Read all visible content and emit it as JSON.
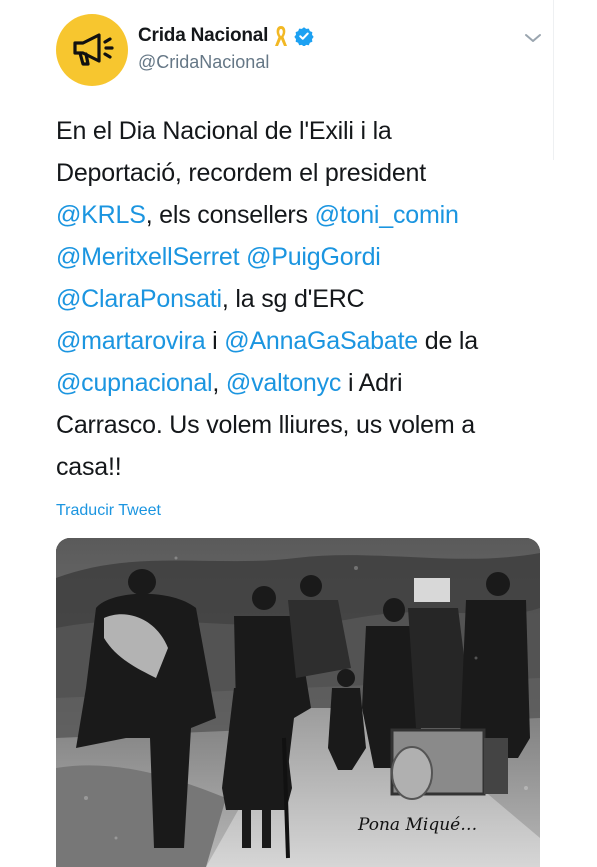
{
  "tweet": {
    "author": {
      "display_name": "Crida Nacional",
      "handle": "@CridaNacional",
      "avatar_icon": "megaphone-icon",
      "ribbon_icon": "yellow-ribbon-icon",
      "verified_icon": "verified-badge-icon"
    },
    "menu_icon": "chevron-down-icon",
    "text": {
      "l1a": "En el Dia Nacional de l'Exili i la",
      "l2a": "Deportació, recordem el president",
      "l3m1": "@KRLS",
      "l3a": ", els consellers ",
      "l3m2": "@toni_comin",
      "l4m1": "@MeritxellSerret",
      "l4a": " ",
      "l4m2": "@PuigGordi",
      "l5m1": "@ClaraPonsati",
      "l5a": ", la sg d'ERC",
      "l6m1": "@martarovira",
      "l6a": " i ",
      "l6m2": "@AnnaGaSabate",
      "l6b": " de la",
      "l7m1": "@cupnacional",
      "l7a": ", ",
      "l7m2": "@valtonyc",
      "l7b": " i Adri",
      "l8a": "Carrasco. Us volem lliures, us volem a",
      "l9a": "casa!!"
    },
    "translate_label": "Traducir Tweet",
    "photo": {
      "signature": "Pona Miqué…"
    }
  },
  "colors": {
    "link": "#1b95e0",
    "avatar_bg": "#f7c62f",
    "verified": "#1da1f2",
    "ribbon": "#f2b824"
  }
}
